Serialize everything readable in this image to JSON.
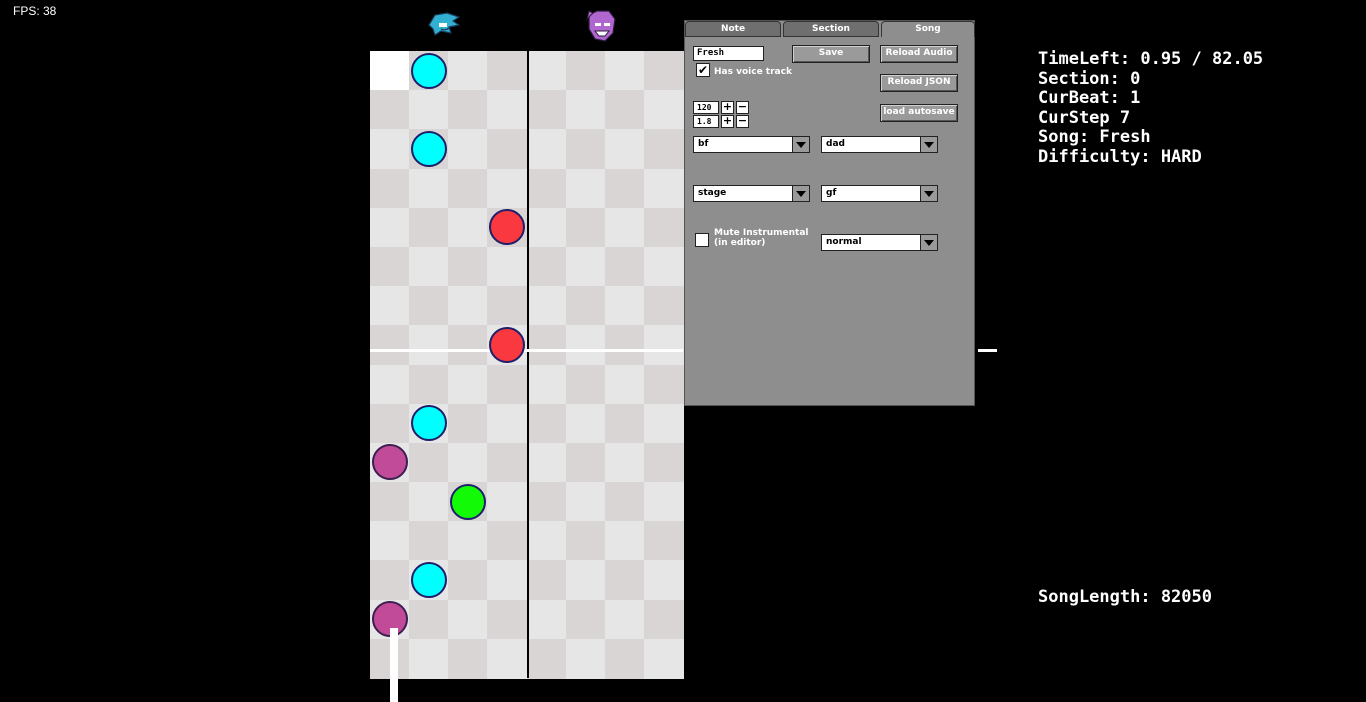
{
  "fps_label": "FPS: 38",
  "icons": {
    "left": "boyfriend-head-icon",
    "right": "opponent-head-icon"
  },
  "colors": {
    "purple_note": "#c24b99",
    "blue_note": "#00ffff",
    "green_note": "#12fa05",
    "red_note": "#f9393f",
    "grid_light": "#e7e6e6",
    "grid_dark": "#d9d5d5"
  },
  "notes": [
    {
      "lane": 1,
      "row": 0,
      "color": "blue"
    },
    {
      "lane": 1,
      "row": 2,
      "color": "blue"
    },
    {
      "lane": 3,
      "row": 4,
      "color": "red"
    },
    {
      "lane": 3,
      "row": 7,
      "color": "red"
    },
    {
      "lane": 1,
      "row": 9,
      "color": "blue"
    },
    {
      "lane": 0,
      "row": 10,
      "color": "purple"
    },
    {
      "lane": 2,
      "row": 11,
      "color": "green"
    },
    {
      "lane": 1,
      "row": 13,
      "color": "blue"
    },
    {
      "lane": 0,
      "row": 14,
      "color": "purple"
    }
  ],
  "panel": {
    "tabs": [
      "Note",
      "Section",
      "Song"
    ],
    "active_tab": "Song",
    "song_name_value": "Fresh",
    "save_label": "Save",
    "reload_audio_label": "Reload Audio",
    "reload_json_label": "Reload JSON",
    "load_autosave_label": "load autosave",
    "has_voice_label": "Has voice track",
    "has_voice_checked": true,
    "bpm_value": "120",
    "speed_value": "1.8",
    "plus_label": "+",
    "minus_label": "−",
    "player1": "bf",
    "player2": "dad",
    "stage": "stage",
    "gf": "gf",
    "mute_label_1": "Mute Instrumental",
    "mute_label_2": "(in editor)",
    "mute_checked": false,
    "note_style": "normal"
  },
  "info": {
    "time_left": "TimeLeft: 0.95 / 82.05",
    "section": "Section: 0",
    "cur_beat": "CurBeat: 1",
    "cur_step": "CurStep 7",
    "song": "Song: Fresh",
    "difficulty": "Difficulty: HARD",
    "song_length": "SongLength: 82050"
  }
}
